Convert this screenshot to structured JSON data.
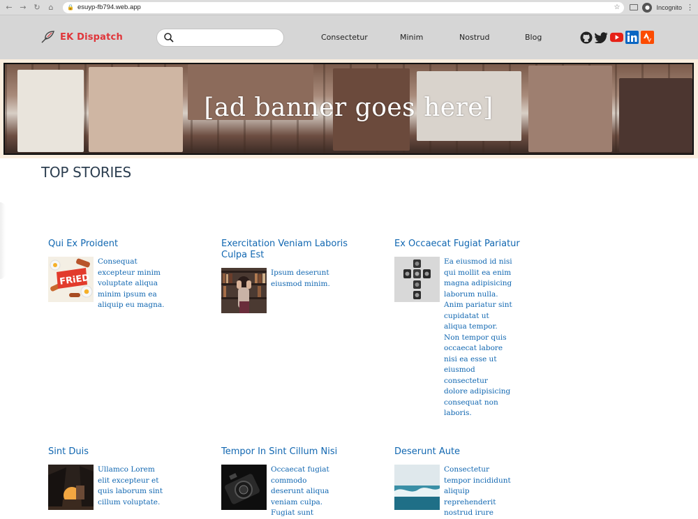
{
  "browser": {
    "url": "esuyp-fb794.web.app",
    "mode_label": "Incognito"
  },
  "site": {
    "brand": "EK Dispatch",
    "search_placeholder": "",
    "nav": [
      "Consectetur",
      "Minim",
      "Nostrud",
      "Blog"
    ],
    "social": [
      "github-icon",
      "twitter-icon",
      "youtube-icon",
      "linkedin-icon",
      "strava-icon"
    ],
    "colors": {
      "brand": "#e0353a",
      "link": "#1167b1",
      "header_bg": "#d6d6d6",
      "banner_bg": "#fbeedf"
    }
  },
  "banner": {
    "text": "[ad banner goes here]"
  },
  "section": {
    "title": "TOP STORIES"
  },
  "stories": [
    {
      "title": "Qui Ex Proident",
      "text": "Consequat excepteur minim voluptate aliqua minim ipsum ea aliquip eu magna.",
      "image": "fried-food-image"
    },
    {
      "title": "Exercitation Veniam Laboris Culpa Est",
      "text": "Ipsum deserunt eiusmod minim.",
      "image": "library-person-image"
    },
    {
      "title": "Ex Occaecat Fugiat Pariatur",
      "text": "Ea eiusmod id nisi qui mollit ea enim magna adipisicing laborum nulla. Anim pariatur sint cupidatat ut aliqua tempor. Non tempor quis occaecat labore nisi ea esse ut eiusmod consectetur dolore adipisicing consequat non laboris.",
      "image": "cameras-image"
    },
    {
      "title": "Sint Duis",
      "text": "Ullamco Lorem elit excepteur et quis laborum sint cillum voluptate.",
      "image": "sunset-tent-image"
    },
    {
      "title": "Tempor In Sint Cillum Nisi",
      "text": "Occaecat fugiat commodo deserunt aliqua veniam culpa. Fugiat sunt",
      "image": "camera-dark-image"
    },
    {
      "title": "Deserunt Aute",
      "text": "Consectetur tempor incididunt aliquip reprehenderit nostrud irure",
      "image": "ocean-wave-image"
    }
  ]
}
